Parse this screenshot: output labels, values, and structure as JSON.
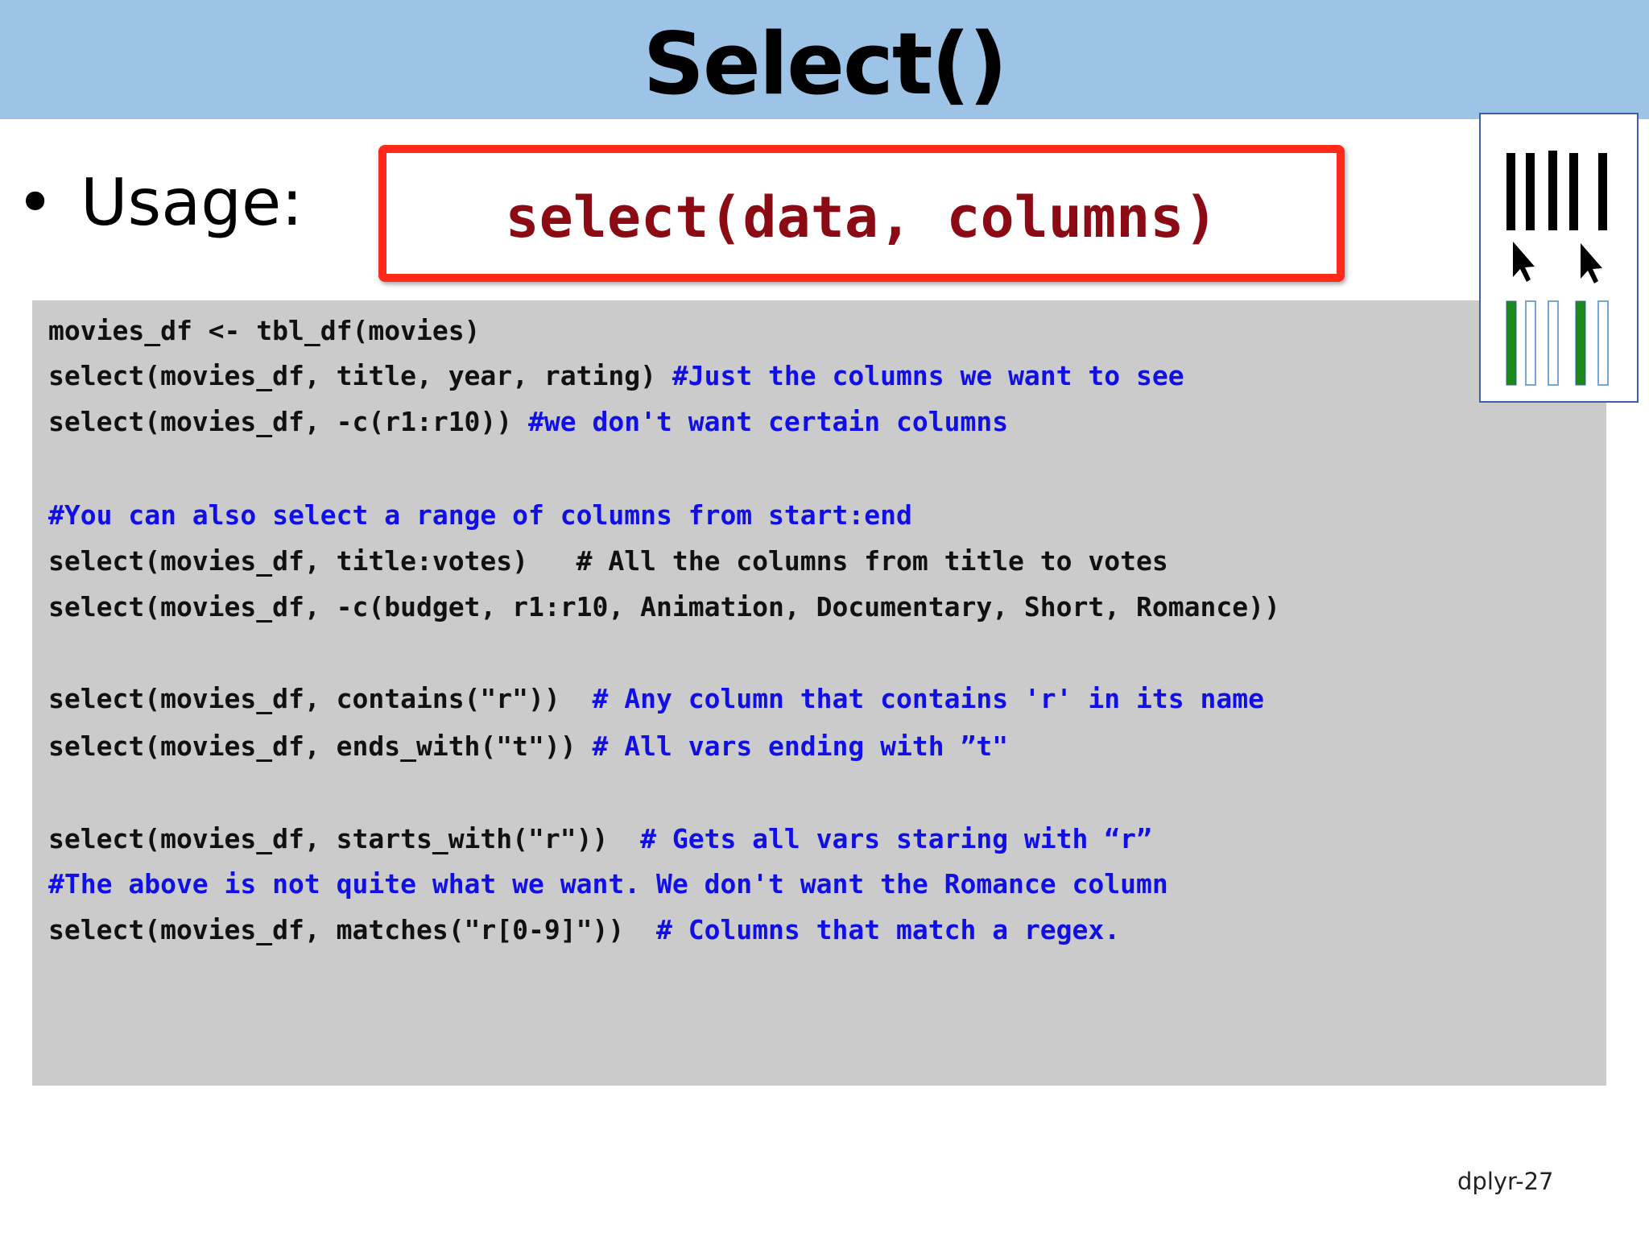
{
  "slide": {
    "title": "Select()",
    "bullet": "•",
    "usage_label": "Usage:",
    "signature": "select(data, columns)",
    "footer": "dplyr-27"
  },
  "code_lines": [
    {
      "code": "movies_df <- tbl_df(movies)",
      "comment": ""
    },
    {
      "code": "select(movies_df, title, year, rating) ",
      "comment": "#Just the columns we want to see"
    },
    {
      "code": "select(movies_df, -c(r1:r10)) ",
      "comment": "#we don't want certain columns"
    },
    {
      "code": "",
      "comment": "#You can also select a range of columns from start:end"
    },
    {
      "code": "select(movies_df, title:votes)   # All the columns from title to votes",
      "comment": ""
    },
    {
      "code": "select(movies_df, -c(budget, r1:r10, Animation, Documentary, Short, Romance))",
      "comment": ""
    },
    {
      "code": "select(movies_df, contains(\"r\"))  ",
      "comment": "# Any column that contains 'r' in its name"
    },
    {
      "code": "select(movies_df, ends_with(\"t\")) ",
      "comment": "# All vars ending with ”t\""
    },
    {
      "code": "select(movies_df, starts_with(\"r\"))  ",
      "comment": "# Gets all vars staring with “r”"
    },
    {
      "code": "",
      "comment": "#The above is not quite what we want. We don't want the Romance column"
    },
    {
      "code": "select(movies_df, matches(\"r[0-9]\"))  ",
      "comment": "# Columns that match a regex."
    }
  ],
  "colors": {
    "title_bar": "#9dc3e6",
    "signature_border": "#ff2a1a",
    "signature_text": "#8b0a14",
    "code_bg": "#cccbcb",
    "comment": "#1010e6",
    "selected_column": "#1a8a1a",
    "unselected_column": "#9dc3e6"
  },
  "icon": {
    "name": "column-select-icon"
  }
}
